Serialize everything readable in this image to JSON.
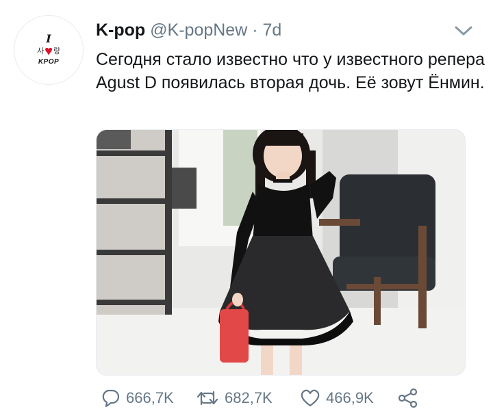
{
  "tweet": {
    "author_name": "K-pop",
    "author_handle": "@K-popNew",
    "separator": "·",
    "time": "7d",
    "text": "Сегодня стало известно что у известного репера Agust D появилась вторая дочь. Её зовут Ёнмин.",
    "avatar": {
      "line1": "I",
      "line2_left": "사",
      "line2_right": "랑",
      "line3": "KPOP"
    }
  },
  "actions": {
    "replies": "666,7K",
    "retweets": "682,7K",
    "likes": "466,9K"
  },
  "icons": {
    "menu": "chevron-down-icon",
    "reply": "reply-icon",
    "retweet": "retweet-icon",
    "like": "heart-icon",
    "share": "share-icon"
  },
  "colors": {
    "text": "#14171a",
    "secondary": "#657786",
    "heart": "#e0102b"
  }
}
